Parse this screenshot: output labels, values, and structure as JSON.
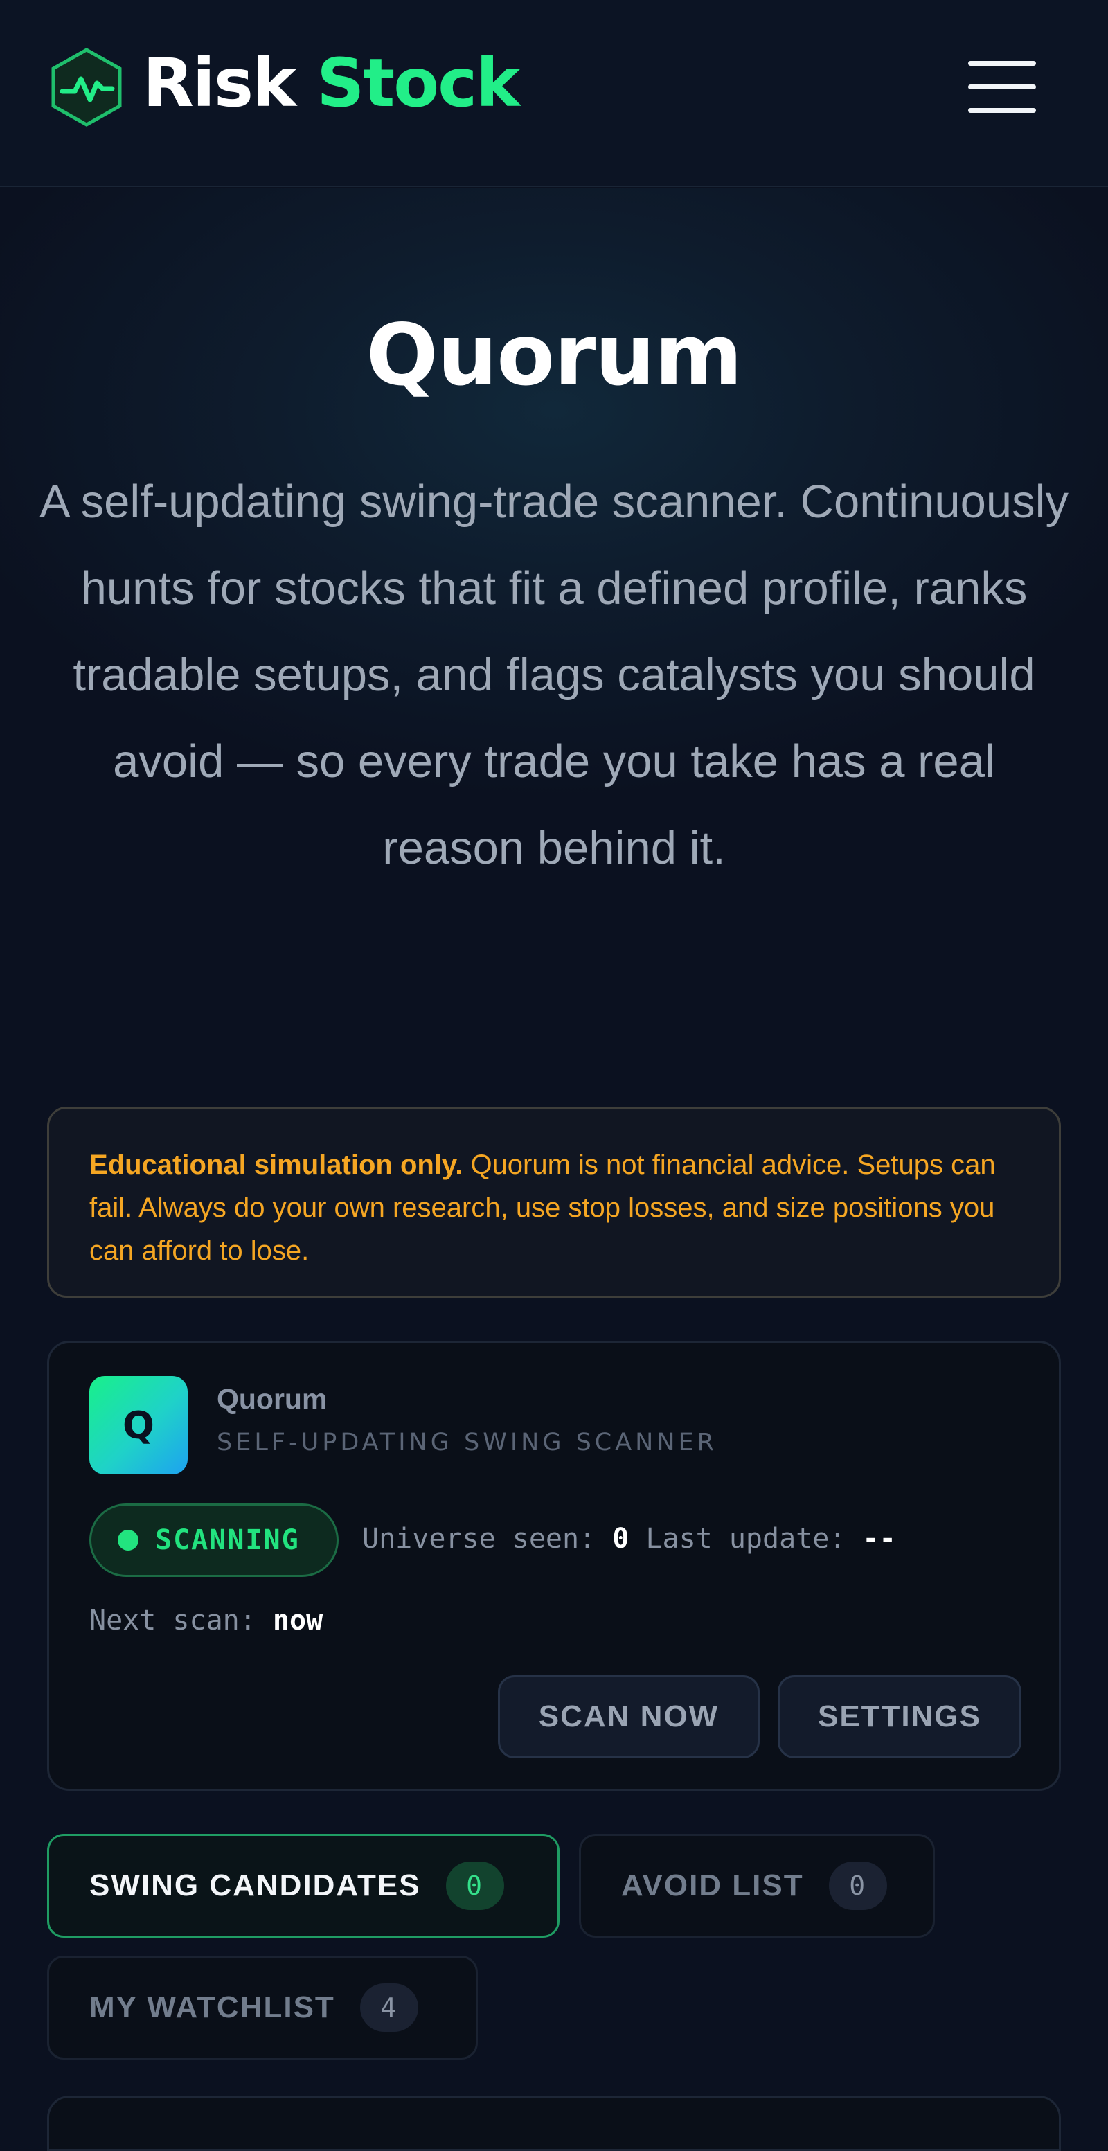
{
  "header": {
    "brand_part1": "Risk",
    "brand_part2": "Stock",
    "logo_icon": "hexagon-pulse-icon",
    "menu_icon": "hamburger-menu-icon"
  },
  "hero": {
    "title": "Quorum",
    "description": "A self-updating swing-trade scanner. Continuously hunts for stocks that fit a defined profile, ranks tradable setups, and flags catalysts you should avoid — so every trade you take has a real reason behind it."
  },
  "disclaimer": {
    "bold": "Educational simulation only.",
    "text": " Quorum is not financial advice. Setups can fail. Always do your own research, use stop losses, and size positions you can afford to lose."
  },
  "scanner": {
    "icon_letter": "Q",
    "name": "Quorum",
    "subtitle": "SELF-UPDATING SWING SCANNER",
    "status": "SCANNING",
    "universe_label": "Universe seen:",
    "universe_value": "0",
    "last_update_label": "Last update:",
    "last_update_value": "--",
    "next_scan_label": "Next scan:",
    "next_scan_value": "now",
    "scan_button": "SCAN NOW",
    "settings_button": "SETTINGS"
  },
  "tabs": [
    {
      "label": "SWING CANDIDATES",
      "count": "0",
      "active": true
    },
    {
      "label": "AVOID LIST",
      "count": "0",
      "active": false
    },
    {
      "label": "MY WATCHLIST",
      "count": "4",
      "active": false
    }
  ],
  "colors": {
    "background": "#0b1120",
    "accent_green": "#22ee88",
    "warning_orange": "#f5a623"
  }
}
